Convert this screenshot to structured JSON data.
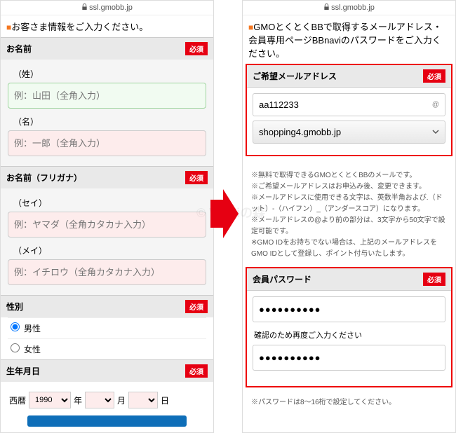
{
  "url": "ssl.gmobb.jp",
  "left": {
    "heading": "お客さま情報をご入力ください。",
    "required_label": "必須",
    "name_section": "お名前",
    "sei_label": "（姓）",
    "sei_placeholder": "例：山田（全角入力）",
    "mei_label": "（名）",
    "mei_placeholder": "例：一郎（全角入力）",
    "kana_section": "お名前（フリガナ）",
    "ksei_label": "（セイ）",
    "ksei_placeholder": "例：ヤマダ（全角カタカナ入力）",
    "kmei_label": "（メイ）",
    "kmei_placeholder": "例：イチロウ（全角カタカナ入力）",
    "gender_section": "性別",
    "gender_m": "男性",
    "gender_f": "女性",
    "dob_section": "生年月日",
    "era": "西暦",
    "year": "1990",
    "y_suffix": "年",
    "m_suffix": "月",
    "d_suffix": "日"
  },
  "right": {
    "heading": "GMOとくとくBBで取得するメールアドレス・会員専用ページBBnaviのパスワードをご入力ください。",
    "email_section": "ご希望メールアドレス",
    "email_value": "aa112233",
    "at": "@",
    "domain": "shopping4.gmobb.jp",
    "notes": [
      "無料で取得できるGMOとくとくBBのメールです。",
      "ご希望メールアドレスはお申込み後、変更できます。",
      "メールアドレスに使用できる文字は、英数半角および.（ドット）-（ハイフン）_（アンダースコア）になります。",
      "メールアドレスの@より前の部分は、3文字から50文字で設定可能です。",
      "GMO IDをお持ちでない場合は、上記のメールアドレスをGMO IDとして登録し、ポイント付与いたします。"
    ],
    "pw_section": "会員パスワード",
    "pw_value": "●●●●●●●●●●",
    "pw_confirm_label": "確認のため再度ご入力ください",
    "pw_confirm_value": "●●●●●●●●●●",
    "pw_note": "パスワードは8～16桁で設定してください。"
  },
  "watermark": "© Wi-Fiの森"
}
